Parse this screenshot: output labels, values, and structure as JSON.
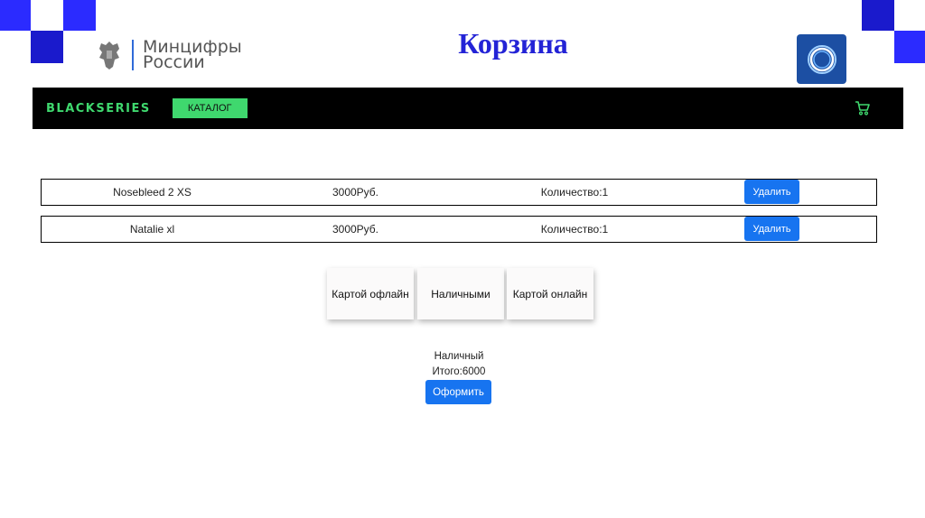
{
  "slide": {
    "title": "Корзина",
    "logo_left": {
      "line1": "Минцифры",
      "line2": "России"
    },
    "logo_right": "ring-logo-icon",
    "accent_color": "#2323d6"
  },
  "navbar": {
    "brand": "BLACKSERIES",
    "catalog_label": "КАТАЛОГ",
    "cart_icon": "cart-icon",
    "accent_color": "#3fd86e"
  },
  "cart": {
    "items": [
      {
        "name": "Nosebleed 2 XS",
        "price": "3000Руб.",
        "quantity": "Количество:1",
        "delete_label": "Удалить"
      },
      {
        "name": "Natalie xl",
        "price": "3000Руб.",
        "quantity": "Количество:1",
        "delete_label": "Удалить"
      }
    ]
  },
  "payment": {
    "options": [
      "Картой офлайн",
      "Наличными",
      "Картой онлайн"
    ]
  },
  "summary": {
    "method": "Наличный",
    "total": "Итого:6000",
    "checkout_label": "Оформить"
  }
}
